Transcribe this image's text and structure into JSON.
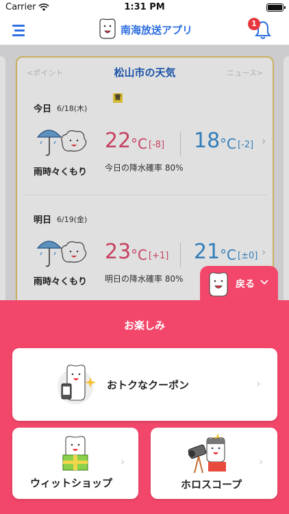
{
  "status_bar": {
    "carrier": "Carrier",
    "time": "1:31 PM"
  },
  "nav": {
    "title": "南海放送アプリ",
    "notification_count": "1"
  },
  "weather": {
    "title": "松山市の天気",
    "prev_link": "<ポイント",
    "next_link": "ニュース>",
    "alert_badge": "雷",
    "days": [
      {
        "label": "今日",
        "date": "6/18(木)",
        "condition": "雨時々くもり",
        "high": "22",
        "high_unit": "°C",
        "high_diff": "[-8]",
        "low": "18",
        "low_unit": "°C",
        "low_diff": "[-2]",
        "precip": "今日の降水確率 80%"
      },
      {
        "label": "明日",
        "date": "6/19(金)",
        "condition": "雨時々くもり",
        "high": "23",
        "high_unit": "°C",
        "high_diff": "[+1]",
        "low": "21",
        "low_unit": "°C",
        "low_diff": "[±0]",
        "precip": "明日の降水確率 80%"
      }
    ]
  },
  "back_tab": {
    "label": "戻る"
  },
  "sheet": {
    "title": "お楽しみ",
    "coupon_label": "おトクなクーポン",
    "shop_label": "ウィットショップ",
    "horoscope_label": "ホロスコープ"
  },
  "colors": {
    "accent": "#f2476a",
    "brand_blue": "#2d6ee0",
    "high_temp": "#e24b6e",
    "low_temp": "#3a8fd3"
  }
}
